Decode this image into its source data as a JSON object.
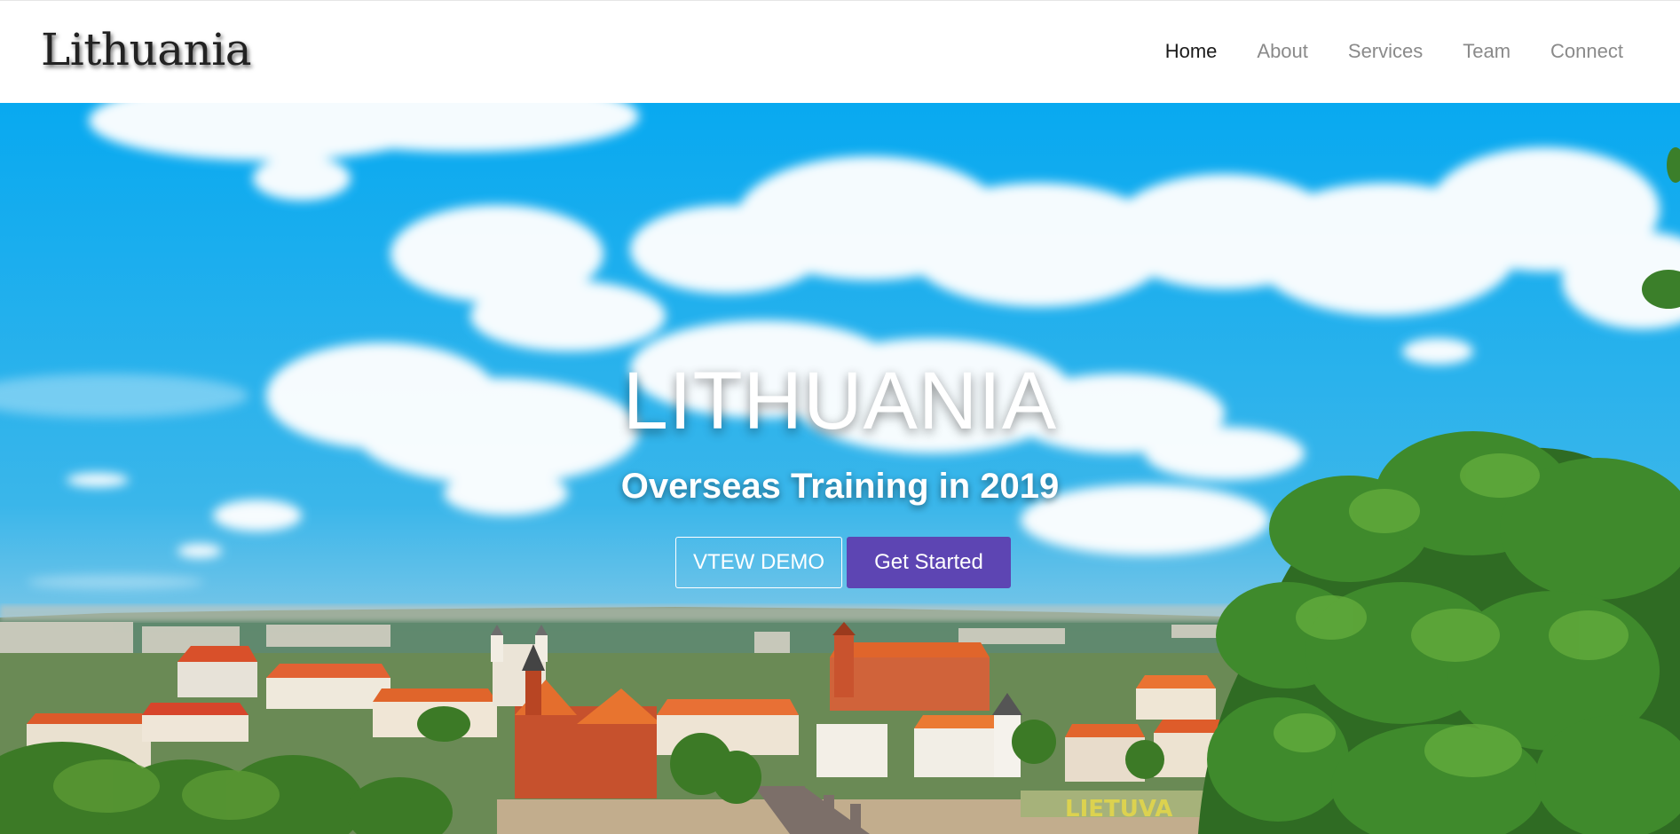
{
  "brand": {
    "name": "Lithuania"
  },
  "nav": {
    "items": [
      {
        "label": "Home",
        "active": true
      },
      {
        "label": "About"
      },
      {
        "label": "Services"
      },
      {
        "label": "Team"
      },
      {
        "label": "Connect"
      }
    ]
  },
  "hero": {
    "title": "LITHUANIA",
    "subtitle": "Overseas Training in 2019",
    "demo_button": "VTEW DEMO",
    "start_button": "Get Started",
    "sign_text": "LIETUVA"
  },
  "colors": {
    "primary": "#5d45b3",
    "sky": "#1aa9ea",
    "roof": "#e0652b",
    "tree": "#3f7f2b"
  }
}
